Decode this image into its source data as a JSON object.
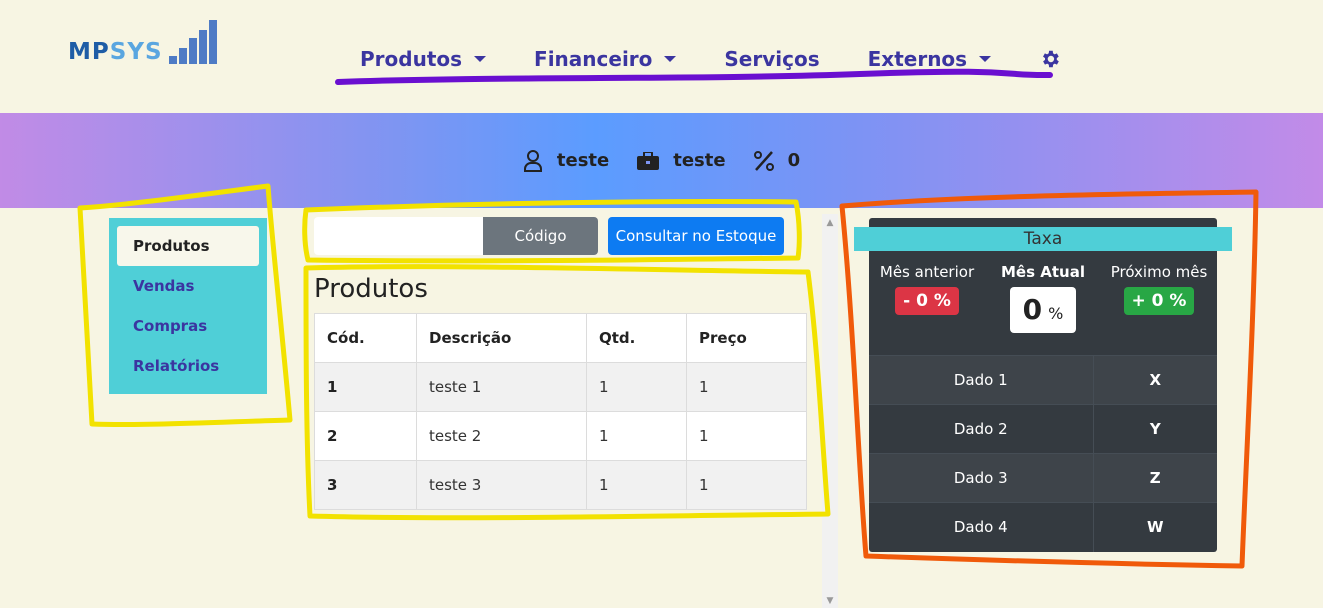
{
  "logo": {
    "part1": "MP",
    "part2": "SYS"
  },
  "nav": {
    "items": [
      {
        "label": "Produtos",
        "dropdown": true
      },
      {
        "label": "Financeiro",
        "dropdown": true
      },
      {
        "label": "Serviços",
        "dropdown": false
      },
      {
        "label": "Externos",
        "dropdown": true
      }
    ],
    "settings_icon": "gear-icon"
  },
  "banner": {
    "user": "teste",
    "company": "teste",
    "percent": "0"
  },
  "sidebar": {
    "items": [
      {
        "label": "Produtos",
        "active": true
      },
      {
        "label": "Vendas",
        "active": false
      },
      {
        "label": "Compras",
        "active": false
      },
      {
        "label": "Relatórios",
        "active": false
      }
    ]
  },
  "search": {
    "value": "",
    "code_label": "Código",
    "consult_label": "Consultar no Estoque"
  },
  "products": {
    "title": "Produtos",
    "columns": [
      "Cód.",
      "Descrição",
      "Qtd.",
      "Preço"
    ],
    "rows": [
      [
        "1",
        "teste 1",
        "1",
        "1"
      ],
      [
        "2",
        "teste 2",
        "1",
        "1"
      ],
      [
        "3",
        "teste 3",
        "1",
        "1"
      ]
    ]
  },
  "taxa": {
    "title": "Taxa",
    "prev_label": "Mês anterior",
    "prev_value": "- 0 %",
    "current_label": "Mês Atual",
    "current_value": "0",
    "current_unit": "%",
    "next_label": "Próximo mês",
    "next_value": "+ 0 %",
    "rows": [
      {
        "label": "Dado 1",
        "value": "X"
      },
      {
        "label": "Dado 2",
        "value": "Y"
      },
      {
        "label": "Dado 3",
        "value": "Z"
      },
      {
        "label": "Dado 4",
        "value": "W"
      }
    ]
  },
  "colors": {
    "accent": "#3b35a0",
    "cyan": "#4fcfd7",
    "annotation_purple": "#6a0fd0",
    "annotation_yellow": "#f2e200",
    "annotation_orange": "#f05a0a"
  }
}
